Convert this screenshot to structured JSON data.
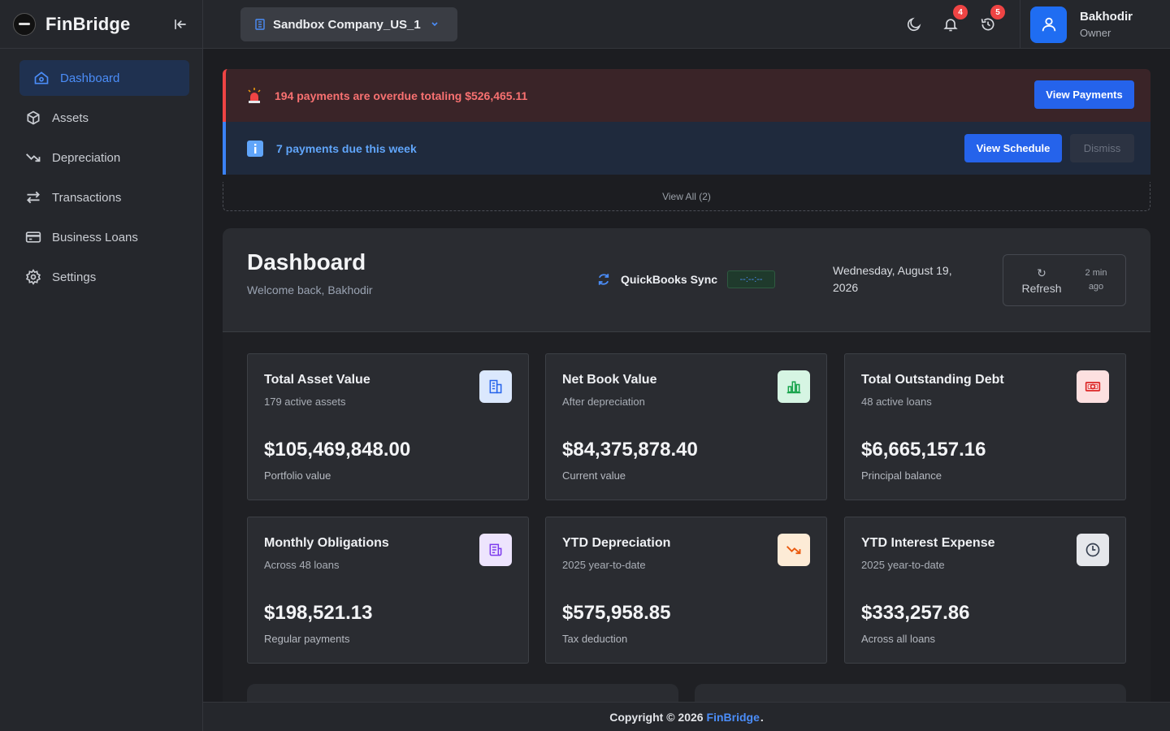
{
  "app": {
    "name": "FinBridge"
  },
  "sidebar": {
    "items": [
      {
        "label": "Dashboard",
        "icon": "home-icon",
        "active": true
      },
      {
        "label": "Assets",
        "icon": "box-icon"
      },
      {
        "label": "Depreciation",
        "icon": "trending-down-icon"
      },
      {
        "label": "Transactions",
        "icon": "arrows-icon"
      },
      {
        "label": "Business Loans",
        "icon": "credit-card-icon"
      },
      {
        "label": "Settings",
        "icon": "gear-icon"
      }
    ]
  },
  "header": {
    "company": "Sandbox Company_US_1",
    "notifications_count": "4",
    "history_count": "5",
    "user": {
      "name": "Bakhodir",
      "role": "Owner"
    }
  },
  "alerts": {
    "overdue": {
      "text": "194 payments are overdue totaling $526,465.11",
      "button": "View Payments"
    },
    "due": {
      "text": "7 payments due this week",
      "button": "View Schedule",
      "dismiss": "Dismiss"
    },
    "view_all": "View All (2)"
  },
  "dashboard": {
    "title": "Dashboard",
    "welcome": "Welcome back, Bakhodir",
    "qb_label": "QuickBooks Sync",
    "qb_status": "--:--:--",
    "date": "Wednesday, August 19, 2026",
    "refresh_icon": "↻",
    "refresh": "Refresh",
    "refresh_ago": "2 min ago"
  },
  "cards": [
    {
      "title": "Total Asset Value",
      "sub": "179 active assets",
      "value": "$105,469,848.00",
      "foot": "Portfolio value",
      "icon": "building-icon",
      "icon_bg": "#dbe8fd",
      "icon_color": "#2563eb"
    },
    {
      "title": "Net Book Value",
      "sub": "After depreciation",
      "value": "$84,375,878.40",
      "foot": "Current value",
      "icon": "bar-chart-icon",
      "icon_bg": "#d6f5e3",
      "icon_color": "#16a34a"
    },
    {
      "title": "Total Outstanding Debt",
      "sub": "48 active loans",
      "value": "$6,665,157.16",
      "foot": "Principal balance",
      "icon": "money-icon",
      "icon_bg": "#fde0e0",
      "icon_color": "#dc2626"
    },
    {
      "title": "Monthly Obligations",
      "sub": "Across 48 loans",
      "value": "$198,521.13",
      "foot": "Regular payments",
      "icon": "receipt-icon",
      "icon_bg": "#ede4fd",
      "icon_color": "#7c3aed"
    },
    {
      "title": "YTD Depreciation",
      "sub": "2025 year-to-date",
      "value": "$575,958.85",
      "foot": "Tax deduction",
      "icon": "trending-down-icon",
      "icon_bg": "#fdebd6",
      "icon_color": "#ea580c"
    },
    {
      "title": "YTD Interest Expense",
      "sub": "2025 year-to-date",
      "value": "$333,257.86",
      "foot": "Across all loans",
      "icon": "clock-icon",
      "icon_bg": "#e5e7eb",
      "icon_color": "#374151"
    }
  ],
  "footer": {
    "prefix": "Copyright © 2026",
    "brand": "FinBridge",
    "suffix": "."
  }
}
